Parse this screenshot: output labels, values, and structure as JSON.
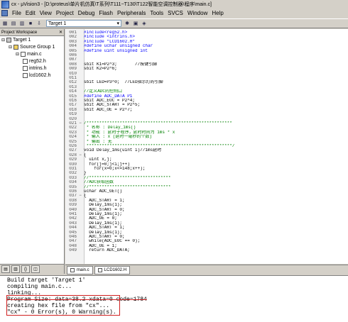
{
  "window": {
    "title": "cx - μVision3 - [D:\\proteus\\单片机仿真\\T系列\\T111~T130\\T122智能空调控制器\\程序\\main.c]"
  },
  "menu": [
    "File",
    "Edit",
    "View",
    "Project",
    "Debug",
    "Flash",
    "Peripherals",
    "Tools",
    "SVCS",
    "Window",
    "Help"
  ],
  "toolbar": {
    "target_select": "Target 1"
  },
  "workspace": {
    "title": "Project Workspace",
    "tree": [
      {
        "label": "Target 1",
        "level": 0
      },
      {
        "label": "Source Group 1",
        "level": 1
      },
      {
        "label": "main.c",
        "level": 2
      },
      {
        "label": "reg52.h",
        "level": 3
      },
      {
        "label": "intrins.h",
        "level": 3
      },
      {
        "label": "lcd1602.h",
        "level": 3
      }
    ]
  },
  "editor": {
    "lines": [
      {
        "n": "001",
        "m": "",
        "t": "#include<reg52.h>"
      },
      {
        "n": "002",
        "m": "",
        "t": "#include <intrins.h>"
      },
      {
        "n": "003",
        "m": "",
        "t": "#include \"LCD1602.H\""
      },
      {
        "n": "004",
        "m": "",
        "t": "#define uchar unsigned char"
      },
      {
        "n": "005",
        "m": "",
        "t": "#define uint unsigned int"
      },
      {
        "n": "006",
        "m": "",
        "t": ""
      },
      {
        "n": "007",
        "m": "",
        "t": ""
      },
      {
        "n": "008",
        "m": "",
        "t": "sbit K1=P2^3;       //按键引脚"
      },
      {
        "n": "009",
        "m": "",
        "t": "sbit K2=P2^6;"
      },
      {
        "n": "010",
        "m": "",
        "t": ""
      },
      {
        "n": "011",
        "m": "",
        "t": ""
      },
      {
        "n": "012",
        "m": "",
        "t": "sbit LED=P3^0;  //LED指示灯的引脚"
      },
      {
        "n": "013",
        "m": "",
        "t": ""
      },
      {
        "n": "014",
        "m": "",
        "t": "//定义ADC的控制口"
      },
      {
        "n": "015",
        "m": "",
        "t": "#define ADC_DATA P1"
      },
      {
        "n": "016",
        "m": "",
        "t": "sbit ADC_EOC = P2^4;"
      },
      {
        "n": "017",
        "m": "",
        "t": "sbit ADC_START = P2^5;"
      },
      {
        "n": "018",
        "m": "",
        "t": "sbit ADC_OE = P2^7;"
      },
      {
        "n": "019",
        "m": "",
        "t": ""
      },
      {
        "n": "020",
        "m": "",
        "t": ""
      },
      {
        "n": "021",
        "m": "−",
        "t": "/*********************************************************"
      },
      {
        "n": "022",
        "m": "",
        "t": " * 名称 : Delay_1ms()"
      },
      {
        "n": "023",
        "m": "",
        "t": " * 功能 : 延时子程序，延时时间为 1ms * x"
      },
      {
        "n": "024",
        "m": "",
        "t": " * 输入 : x (延时一毫秒的个数)"
      },
      {
        "n": "025",
        "m": "",
        "t": " * 输出 : 无"
      },
      {
        "n": "026",
        "m": "",
        "t": " *********************************************************/"
      },
      {
        "n": "027",
        "m": "",
        "t": "void Delay_1ms(uint i)//1ms延时"
      },
      {
        "n": "028",
        "m": "−",
        "t": "{"
      },
      {
        "n": "029",
        "m": "",
        "t": "  uint x,j;"
      },
      {
        "n": "030",
        "m": "",
        "t": "  for(j=0;j<i;j++)"
      },
      {
        "n": "031",
        "m": "",
        "t": "    for(x=0;x<=148;x++);"
      },
      {
        "n": "032",
        "m": "",
        "t": "}"
      },
      {
        "n": "033",
        "m": "",
        "t": "//********************************"
      },
      {
        "n": "034",
        "m": "",
        "t": "//ADC获取函数"
      },
      {
        "n": "035",
        "m": "",
        "t": "//********************************"
      },
      {
        "n": "036",
        "m": "",
        "t": "uchar ADC_GET()"
      },
      {
        "n": "037",
        "m": "−",
        "t": "{"
      },
      {
        "n": "038",
        "m": "",
        "t": "  ADC_START = 1;"
      },
      {
        "n": "039",
        "m": "",
        "t": "  Delay_1ms(1);"
      },
      {
        "n": "040",
        "m": "",
        "t": "  ADC_START = 0;"
      },
      {
        "n": "041",
        "m": "",
        "t": "  Delay_1ms(1);"
      },
      {
        "n": "042",
        "m": "",
        "t": "  ADC_OE = 0;"
      },
      {
        "n": "043",
        "m": "",
        "t": "  Delay_1ms(1);"
      },
      {
        "n": "044",
        "m": "",
        "t": "  ADC_START = 1;"
      },
      {
        "n": "045",
        "m": "",
        "t": "  Delay_1ms(1);"
      },
      {
        "n": "046",
        "m": "",
        "t": "  ADC_START = 0;"
      },
      {
        "n": "047",
        "m": "",
        "t": "  while(ADC_EOC == 0);"
      },
      {
        "n": "048",
        "m": "",
        "t": "  ADC_OE = 1;"
      },
      {
        "n": "049",
        "m": "",
        "t": "  return ADC_DATA;"
      }
    ],
    "tabs": [
      "main.c",
      "LCD1602.H"
    ]
  },
  "output": {
    "lines": [
      "Build target 'Target 1'",
      "compiling main.c...",
      "linking...",
      "Program Size: data=38.2 xdata=0 code=1784",
      "creating hex file from \"cx\"...",
      "\"cx\" - 0 Error(s), 0 Warning(s)."
    ]
  },
  "colors": {
    "comment": "#008000",
    "keyword": "#0000ff",
    "string": "#a31515",
    "highlight_box": "#d02020"
  }
}
